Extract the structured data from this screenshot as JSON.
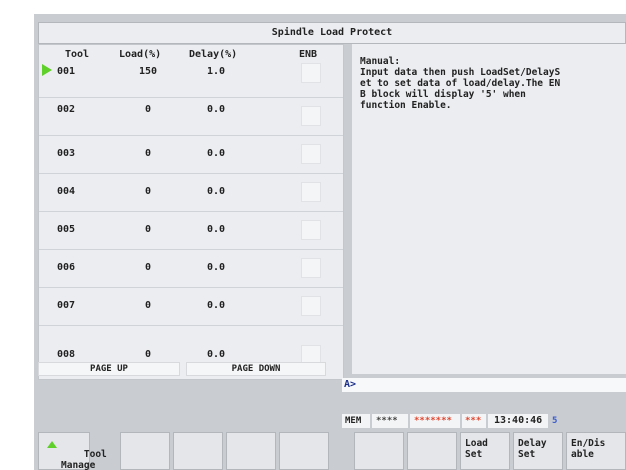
{
  "screen_title": "Spindle Load Protect",
  "columns": {
    "tool": "Tool",
    "load": "Load(%)",
    "delay": "Delay(%)",
    "enb": "ENB"
  },
  "rows": [
    {
      "tool": "001",
      "load": "150",
      "delay": "1.0",
      "selected": true
    },
    {
      "tool": "002",
      "load": "0",
      "delay": "0.0"
    },
    {
      "tool": "003",
      "load": "0",
      "delay": "0.0"
    },
    {
      "tool": "004",
      "load": "0",
      "delay": "0.0"
    },
    {
      "tool": "005",
      "load": "0",
      "delay": "0.0"
    },
    {
      "tool": "006",
      "load": "0",
      "delay": "0.0"
    },
    {
      "tool": "007",
      "load": "0",
      "delay": "0.0"
    },
    {
      "tool": "008",
      "load": "0",
      "delay": "0.0"
    }
  ],
  "page_up": "PAGE UP",
  "page_down": "PAGE DOWN",
  "manual": {
    "heading": "Manual:",
    "text": "Input data then push LoadSet/DelayS\net to set data of load/delay.The EN\nB block will display '5' when\nfunction Enable."
  },
  "input_prompt": "A>",
  "status": {
    "mode": "MEM",
    "stars1": "****",
    "stars2": "*******",
    "stars3": "***",
    "time": "13:40:46",
    "number": "5"
  },
  "colors": {
    "cursor": "#5fcf2a",
    "star_red": "#e2452e",
    "screen_bg": "#c9cdd2",
    "prompt": "#1b2f8a"
  },
  "softkeys": [
    "Tool\nManage",
    "",
    "",
    "",
    "",
    "",
    "",
    "Load\nSet",
    "Delay\nSet",
    "En/Dis\nable"
  ]
}
